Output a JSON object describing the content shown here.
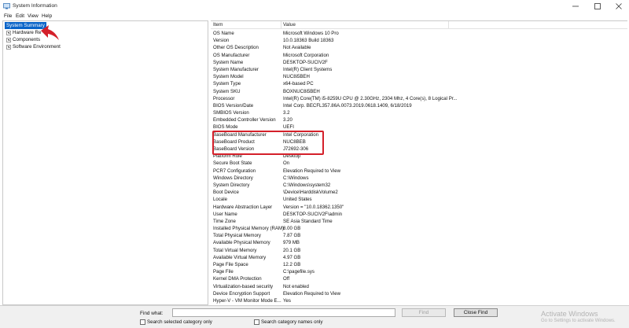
{
  "window": {
    "title": "System Information",
    "icon": "system-information-icon",
    "controls": [
      "minimize-icon",
      "maximize-icon",
      "close-icon"
    ]
  },
  "menu": {
    "file": "File",
    "edit": "Edit",
    "view": "View",
    "help": "Help"
  },
  "tree": {
    "root": "System Summary",
    "children": [
      "Hardware Re",
      "Components",
      "Software Environment"
    ]
  },
  "table": {
    "headers": {
      "item": "Item",
      "value": "Value"
    },
    "rows": [
      {
        "item": "OS Name",
        "value": "Microsoft Windows 10 Pro"
      },
      {
        "item": "Version",
        "value": "10.0.18363 Build 18363"
      },
      {
        "item": "Other OS Description",
        "value": "Not Available"
      },
      {
        "item": "OS Manufacturer",
        "value": "Microsoft Corporation"
      },
      {
        "item": "System Name",
        "value": "DESKTOP-SUCIV2F"
      },
      {
        "item": "System Manufacturer",
        "value": "Intel(R) Client Systems"
      },
      {
        "item": "System Model",
        "value": "NUC8i5BEH"
      },
      {
        "item": "System Type",
        "value": "x64-based PC"
      },
      {
        "item": "System SKU",
        "value": "BOXNUC8i5BEH"
      },
      {
        "item": "Processor",
        "value": "Intel(R) Core(TM) i5-8259U CPU @ 2.30GHz, 2304 Mhz, 4 Core(s), 8 Logical Pr..."
      },
      {
        "item": "BIOS Version/Date",
        "value": "Intel Corp. BECFL357.86A.0073.2019.0618.1409, 6/18/2019"
      },
      {
        "item": "SMBIOS Version",
        "value": "3.2"
      },
      {
        "item": "Embedded Controller Version",
        "value": "3.20"
      },
      {
        "item": "BIOS Mode",
        "value": "UEFI"
      },
      {
        "item": "BaseBoard Manufacturer",
        "value": "Intel Corporation"
      },
      {
        "item": "BaseBoard Product",
        "value": "NUC8BEB"
      },
      {
        "item": "BaseBoard Version",
        "value": "J72692-306"
      },
      {
        "item": "Platform Role",
        "value": "Desktop"
      },
      {
        "item": "Secure Boot State",
        "value": "On"
      },
      {
        "item": "PCR7 Configuration",
        "value": "Elevation Required to View"
      },
      {
        "item": "Windows Directory",
        "value": "C:\\Windows"
      },
      {
        "item": "System Directory",
        "value": "C:\\Windows\\system32"
      },
      {
        "item": "Boot Device",
        "value": "\\Device\\HarddiskVolume2"
      },
      {
        "item": "Locale",
        "value": "United States"
      },
      {
        "item": "Hardware Abstraction Layer",
        "value": "Version = \"10.0.18362.1350\""
      },
      {
        "item": "User Name",
        "value": "DESKTOP-SUCIV2F\\admin"
      },
      {
        "item": "Time Zone",
        "value": "SE Asia Standard Time"
      },
      {
        "item": "Installed Physical Memory (RAM)",
        "value": "8.00 GB"
      },
      {
        "item": "Total Physical Memory",
        "value": "7.87 GB"
      },
      {
        "item": "Available Physical Memory",
        "value": "979 MB"
      },
      {
        "item": "Total Virtual Memory",
        "value": "20.1 GB"
      },
      {
        "item": "Available Virtual Memory",
        "value": "4.97 GB"
      },
      {
        "item": "Page File Space",
        "value": "12.2 GB"
      },
      {
        "item": "Page File",
        "value": "C:\\pagefile.sys"
      },
      {
        "item": "Kernel DMA Protection",
        "value": "Off"
      },
      {
        "item": "Virtualization-based security",
        "value": "Not enabled"
      },
      {
        "item": "Device Encryption Support",
        "value": "Elevation Required to View"
      },
      {
        "item": "Hyper-V - VM Monitor Mode E...",
        "value": "Yes"
      }
    ]
  },
  "find": {
    "label": "Find what:",
    "value": "",
    "find_button": "Find",
    "close_button": "Close Find",
    "check_selected": "Search selected category only",
    "check_names": "Search category names only"
  },
  "watermark": {
    "title": "Activate Windows",
    "subtitle": "Go to Settings to activate Windows."
  },
  "colors": {
    "selection": "#0a64c8",
    "annotation": "#d4202a"
  }
}
